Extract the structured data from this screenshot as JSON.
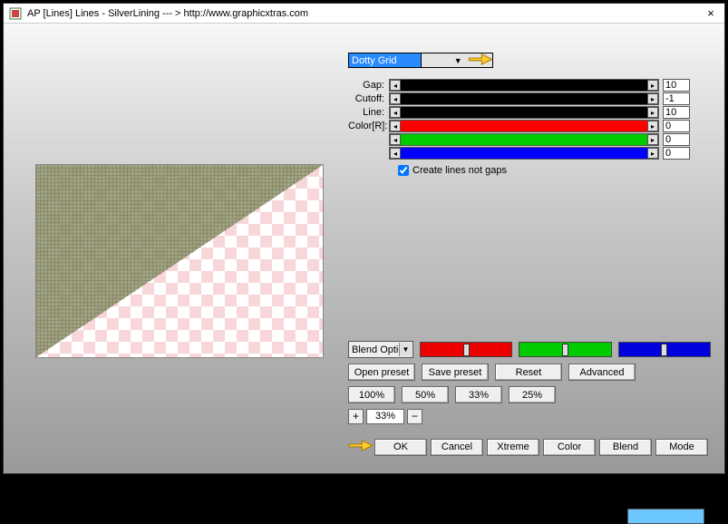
{
  "window": {
    "title": "AP [Lines]  Lines - SilverLining    --- >  http://www.graphicxtras.com",
    "close_glyph": "×"
  },
  "preset_dropdown": {
    "selected": "Dotty Grid"
  },
  "sliders": {
    "gap": {
      "label": "Gap:",
      "value": "10"
    },
    "cutoff": {
      "label": "Cutoff:",
      "value": "-1"
    },
    "line": {
      "label": "Line:",
      "value": "10"
    },
    "r": {
      "label": "Color[R]:",
      "value": "0"
    },
    "g": {
      "label": "",
      "value": "0"
    },
    "b": {
      "label": "",
      "value": "0"
    }
  },
  "checkbox": {
    "label": "Create lines not gaps",
    "checked": true
  },
  "blend_select": {
    "label": "Blend Optio"
  },
  "preset_buttons": {
    "open": "Open preset",
    "save": "Save preset",
    "reset": "Reset",
    "adv": "Advanced"
  },
  "pct_buttons": {
    "p100": "100%",
    "p50": "50%",
    "p33": "33%",
    "p25": "25%"
  },
  "zoom": {
    "plus": "+",
    "minus": "−",
    "value": "33%"
  },
  "actions": {
    "ok": "OK",
    "cancel": "Cancel",
    "xtreme": "Xtreme",
    "color": "Color",
    "blend": "Blend",
    "mode": "Mode"
  },
  "arrow_glyphs": {
    "left": "◂",
    "right": "▸",
    "down": "▼"
  }
}
